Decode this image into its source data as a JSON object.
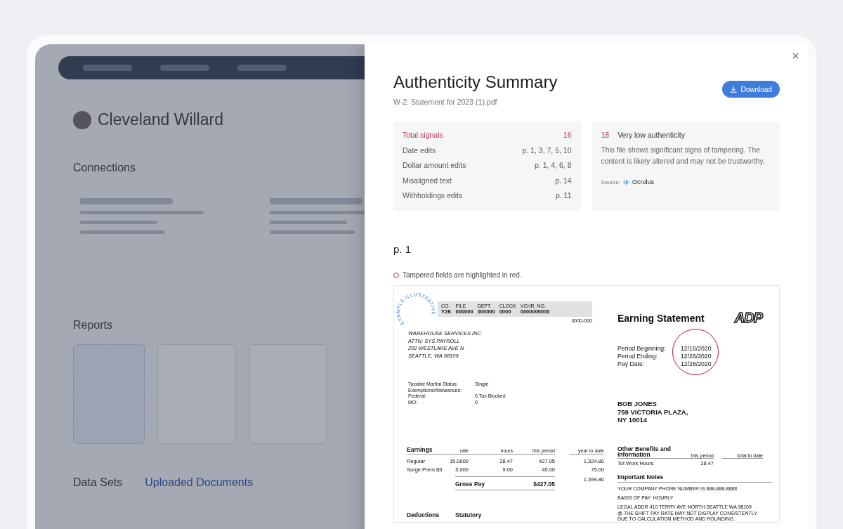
{
  "background": {
    "user_name": "Cleveland Willard",
    "sections": [
      "Connections",
      "Reports"
    ],
    "data_sets": {
      "title": "Data Sets",
      "tab": "Uploaded Documents"
    }
  },
  "panel": {
    "title": "Authenticity Summary",
    "file_name": "W-2: Statement for 2023 (1).pdf",
    "download_label": "Download",
    "signals": [
      {
        "kind": "total",
        "label": "Total signals",
        "pages": "16"
      },
      {
        "kind": "item",
        "label": "Date edits",
        "pages": "p. 1, 3, 7, 5, 10"
      },
      {
        "kind": "item",
        "label": "Dollar amount edits",
        "pages": "p. 1, 4, 6, 8"
      },
      {
        "kind": "item",
        "label": "Misaligned text",
        "pages": "p. 14"
      },
      {
        "kind": "item",
        "label": "Withholdings edits",
        "pages": "p. 11"
      }
    ],
    "score": {
      "value": "18",
      "label": "Very low authenticity",
      "description": "This file shows significant signs of tampering. The content is likely altered and may not be trustworthy.",
      "source_label": "Source:",
      "source_name": "Ocrolus"
    },
    "page_label": "p. 1",
    "legend": "Tampered fields are highlighted in red."
  },
  "document": {
    "stamp": "EXAMPLE ILLUSTRATIVE",
    "header_fields": [
      {
        "label": "CO.",
        "value": "Y2K"
      },
      {
        "label": "FILE",
        "value": "000000"
      },
      {
        "label": "DEPT.",
        "value": "000000"
      },
      {
        "label": "CLOCK",
        "value": "0000"
      },
      {
        "label": "VCHR. NO.",
        "value": "0000000000"
      }
    ],
    "header_code": "0000-000",
    "company_address": [
      "WAREHOUSE SERVICES INC",
      "ATTN: SYS PAYROLL",
      "202 WESTLAKE AVE N",
      "SEATTLE, WA 98109"
    ],
    "tax_info": [
      {
        "label": "Taxable Marital Status:",
        "value": "Single"
      },
      {
        "label": "Exemptions/Allowances:"
      },
      {
        "label": "Federal:",
        "value": "0,Tax Blocked"
      },
      {
        "label": "MO:",
        "value": "0"
      }
    ],
    "title": "Earning Statement",
    "logo": "ADP",
    "period": {
      "tampered": true,
      "rows": [
        {
          "label": "Period Beginning:",
          "value": "12/16/2020"
        },
        {
          "label": "Period Ending:",
          "value": "12/26/2020"
        },
        {
          "label": "Pay Date:",
          "value": "12/28/2020"
        }
      ]
    },
    "employee": [
      "BOB JONES",
      "759 VICTORIA PLAZA,",
      "NY 10014"
    ],
    "earnings": {
      "title": "Earnings",
      "columns": [
        "rate",
        "hours",
        "this period"
      ],
      "ytd_column": "year to date",
      "rows": [
        {
          "name": "Regular",
          "rate": "15.0000",
          "hours": "28.47",
          "period": "427.05",
          "ytd": "1,324.80"
        },
        {
          "name": "Surge Prem $5",
          "rate": "5.000",
          "hours": "9.00",
          "period": "45.00",
          "ytd": "75.00"
        }
      ],
      "gross_label": "Gross Pay",
      "gross_value": "$427.05",
      "gross_ytd": "1,399.80"
    },
    "benefits": {
      "title": "Other Benefits and Information",
      "columns": [
        "this period",
        "total to date"
      ],
      "rows": [
        {
          "name": "Tot Work Hours",
          "period": "28.47"
        }
      ]
    },
    "notes": {
      "title": "Important Notes",
      "paragraphs": [
        [
          "YOUR COMPANY PHONE NUMBER IS 888-888-8888"
        ],
        [
          "BASIS OF PAY: HOURLY"
        ],
        [
          "LEGAL ADDR 410 TERRY AVE NORTH SEATTLE WA 98109",
          "@ THE SHIFT PAY RATE MAY NOT DISPLAY CONSISTENTLY",
          "DUE TO CALCULATION METHOD AND ROUNDING."
        ]
      ]
    },
    "deductions": {
      "title": "Deductions",
      "subtitle": "Statutory"
    }
  }
}
